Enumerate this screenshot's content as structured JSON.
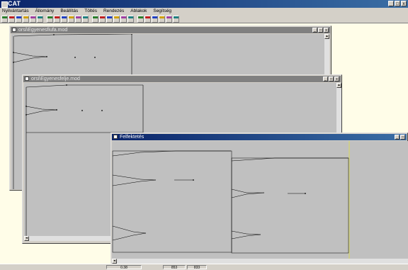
{
  "app": {
    "title": "CAT"
  },
  "menu": [
    "Nyilvántartás",
    "Állomány",
    "Beállítás",
    "Töltés",
    "Rendezés",
    "Ablakok",
    "Segítség"
  ],
  "toolbar_icons": [
    "new-icon",
    "open-icon",
    "save-icon",
    "print-icon",
    "cut-icon",
    "copy-icon",
    "paste-icon",
    "undo-icon",
    "zoom-in-icon",
    "zoom-out-icon",
    "zoom-fit-icon",
    "measure-icon",
    "point-icon",
    "line-icon",
    "curve-icon",
    "grid-icon",
    "layer-icon",
    "rotate-icon",
    "mirror-icon",
    "color-icon",
    "export-icon",
    "import-icon",
    "settings-icon",
    "help-icon"
  ],
  "windows": {
    "w1": {
      "title": "orsi\\Egyenesfiufa.mod"
    },
    "w2": {
      "title": "orsi\\Egyenesfelje.mod"
    },
    "w3": {
      "title": "Felfektetés"
    }
  },
  "status": [
    "0.38",
    "853",
    "833"
  ],
  "colors": {
    "title_active": "#0a246a",
    "title_inactive": "#808080",
    "client": "#fffde8"
  }
}
